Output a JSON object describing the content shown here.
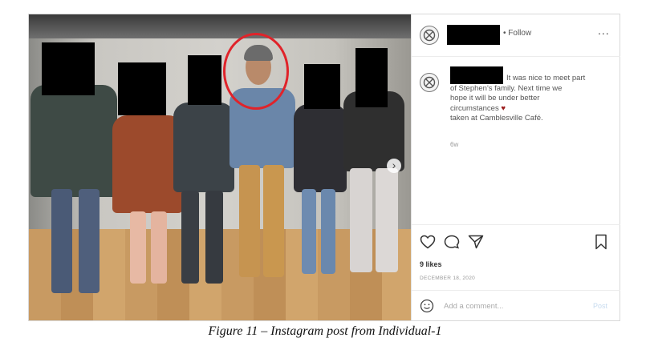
{
  "post": {
    "header": {
      "follow_label": "• Follow",
      "more_label": "..."
    },
    "caption": {
      "line1": "It was nice to meet part",
      "line2": "of Stephen's family. Next time we",
      "line3": "hope it will be under better",
      "line4": "circumstances",
      "line5": "taken at Camblesville Café.",
      "age": "6w"
    },
    "likes": "9 likes",
    "date": "DECEMBER 18, 2020",
    "comment": {
      "placeholder": "Add a comment...",
      "post_label": "Post"
    },
    "icons": [
      "heart-icon",
      "comment-icon",
      "share-icon",
      "bookmark-icon",
      "emoji-icon",
      "crossed-circle-avatar-icon",
      "chevron-right-icon"
    ],
    "colors": {
      "highlight": "#e0232a",
      "heart": "#9b1b1b",
      "link_disabled": "#c7dbef"
    }
  },
  "figure_caption": "Figure 11 – Instagram post from Individual-1"
}
